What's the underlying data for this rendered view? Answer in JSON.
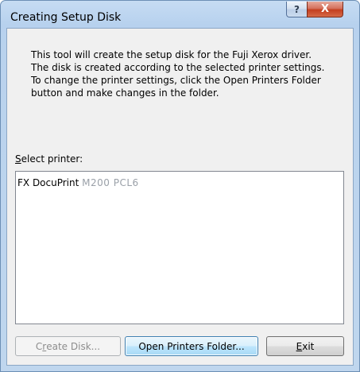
{
  "window": {
    "title": "Creating Setup Disk"
  },
  "titlebar": {
    "help_label": "?",
    "close_label": "X"
  },
  "description": "This tool will create the setup disk for the Fuji Xerox driver.\nThe disk is created according to the selected printer settings.\nTo change the printer settings, click the Open Printers Folder\nbutton and make changes in the folder.",
  "select_printer": {
    "label_accel": "S",
    "label_rest": "elect printer:"
  },
  "printers": [
    {
      "name": "FX DocuPrint",
      "model": "M200 PCL6"
    }
  ],
  "buttons": {
    "create_disk": {
      "pre": "C",
      "accel": "r",
      "post": "eate Disk...",
      "enabled": false
    },
    "open_printers_folder": {
      "label": "Open Printers Folder..."
    },
    "exit": {
      "accel": "E",
      "post": "xit"
    }
  },
  "colors": {
    "title_bar": "#b9d2ed",
    "client_bg": "#f0f0f0",
    "close_button": "#c43e1f",
    "default_button_border": "#3c7fb1"
  }
}
